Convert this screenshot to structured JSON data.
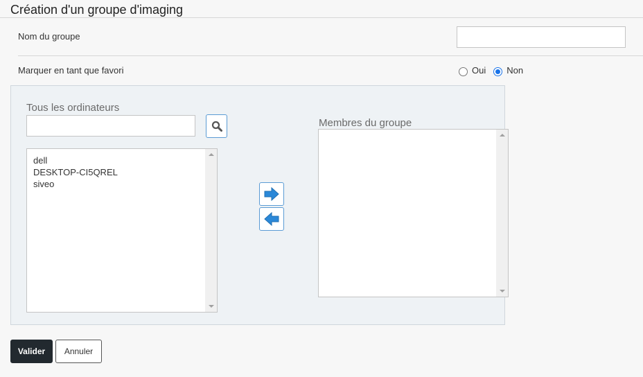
{
  "header": {
    "title": "Création d'un groupe d'imaging"
  },
  "form": {
    "name_label": "Nom du groupe",
    "name_value": "",
    "favorite_label": "Marquer en tant que favori",
    "favorite_options": [
      {
        "label": "Oui",
        "checked": false
      },
      {
        "label": "Non",
        "checked": true
      }
    ]
  },
  "selector": {
    "all_computers_label": "Tous les ordinateurs",
    "search_value": "",
    "computers": [
      "dell",
      "DESKTOP-CI5QREL",
      "siveo"
    ],
    "members_label": "Membres du groupe",
    "members": []
  },
  "actions": {
    "submit_label": "Valider",
    "cancel_label": "Annuler"
  },
  "colors": {
    "accent": "#1a73e8",
    "arrow": "#2b88d8",
    "submit_bg": "#22292f"
  }
}
